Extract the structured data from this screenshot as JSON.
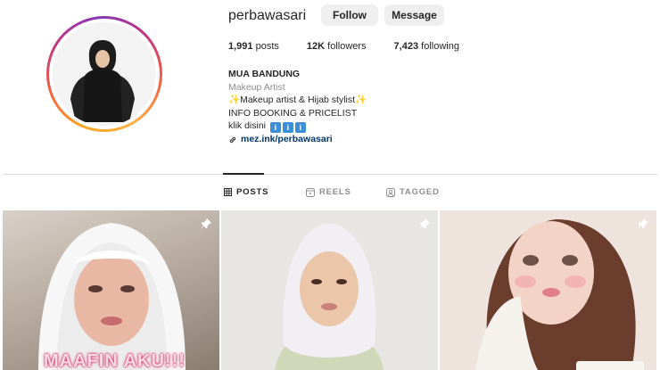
{
  "profile": {
    "username": "perbawasari",
    "follow_label": "Follow",
    "message_label": "Message"
  },
  "stats": {
    "posts_count": "1,991",
    "posts_label": "posts",
    "followers_count": "12K",
    "followers_label": "followers",
    "following_count": "7,423",
    "following_label": "following"
  },
  "bio": {
    "name": "MUA BANDUNG",
    "category": "Makeup Artist",
    "line1": "Makeup artist & Hijab stylist",
    "line2": "INFO BOOKING & PRICELIST",
    "line3": "klik disini",
    "link": "mez.ink/perbawasari"
  },
  "tabs": [
    {
      "label": "POSTS",
      "icon": "grid-icon",
      "active": true
    },
    {
      "label": "REELS",
      "icon": "reels-icon",
      "active": false
    },
    {
      "label": "TAGGED",
      "icon": "tagged-icon",
      "active": false
    }
  ],
  "posts": [
    {
      "overlay_text": "MAAFIN AKU!!!",
      "pinned": true
    },
    {
      "overlay_text": "",
      "pinned": true
    },
    {
      "overlay_text": "",
      "pinned": true
    }
  ],
  "colors": {
    "accent_link": "#00376b",
    "button_bg": "#efefef",
    "story_ring_start": "#f9a826",
    "story_ring_end": "#c13584"
  }
}
